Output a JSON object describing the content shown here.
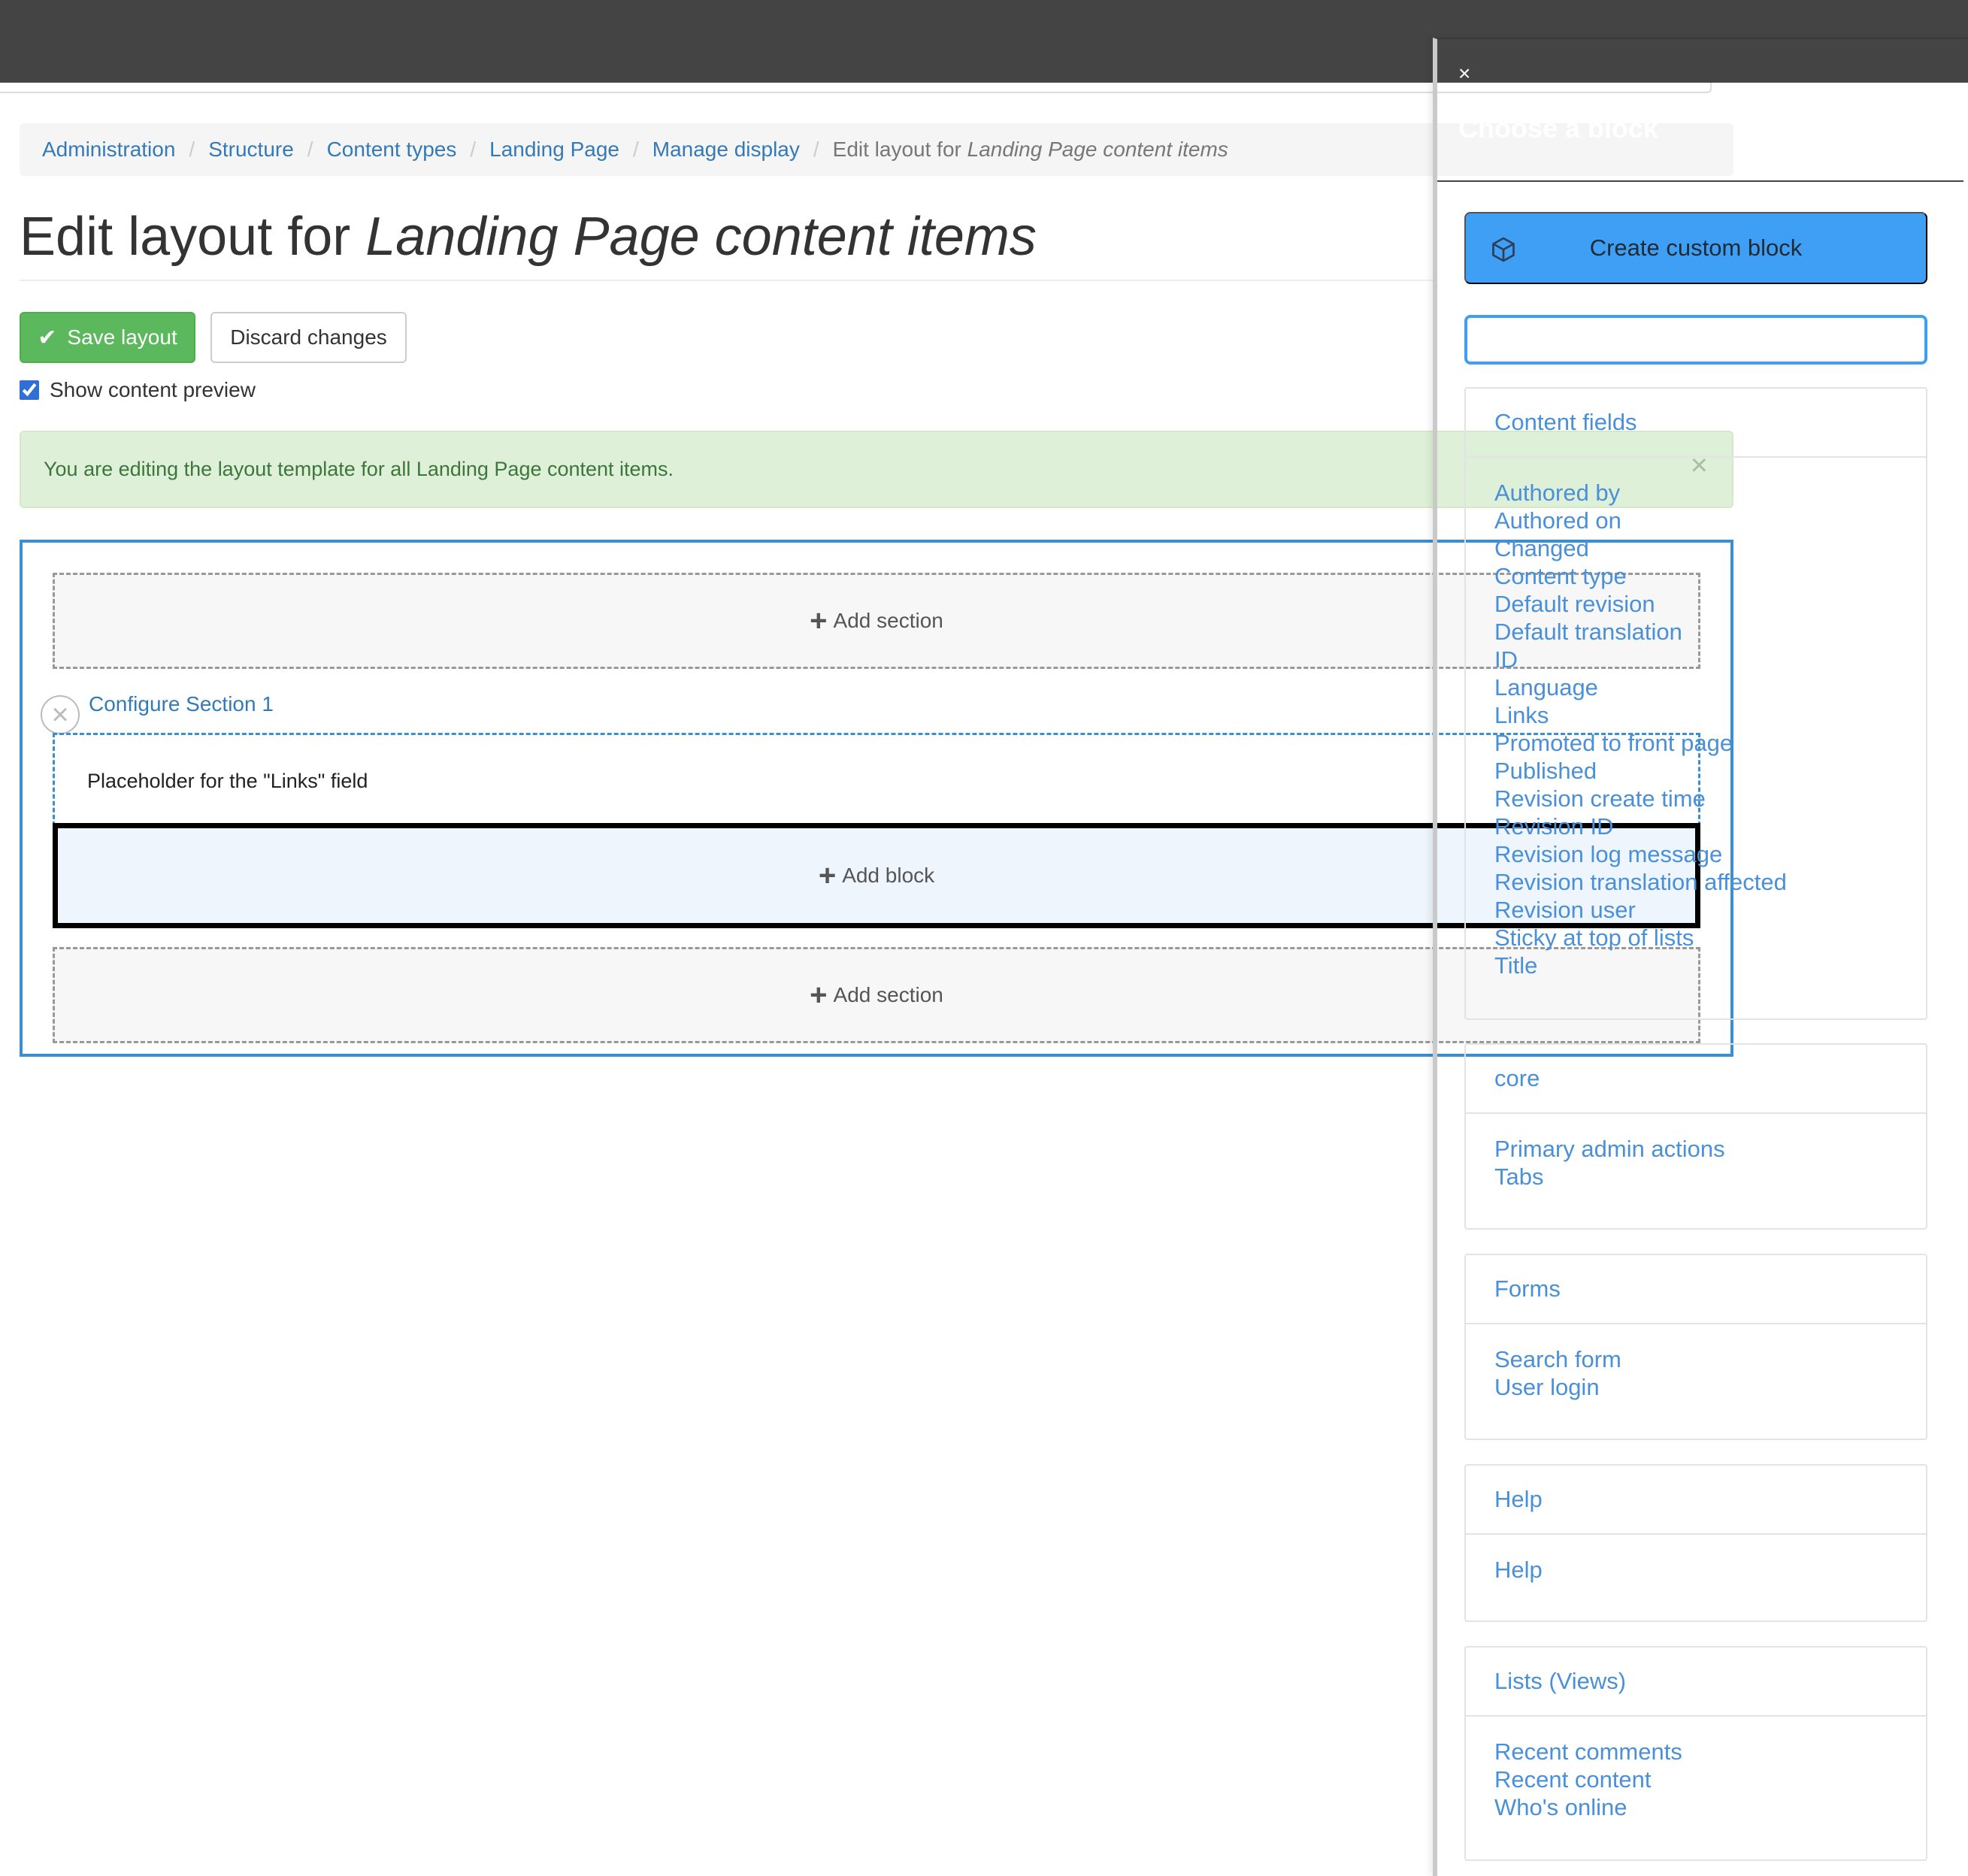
{
  "breadcrumb": {
    "items": [
      "Administration",
      "Structure",
      "Content types",
      "Landing Page",
      "Manage display"
    ],
    "active_prefix": "Edit layout for",
    "active_em": "Landing Page content items"
  },
  "page": {
    "title_prefix": "Edit layout for",
    "title_em": "Landing Page content items"
  },
  "actions": {
    "save_label": "Save layout",
    "discard_label": "Discard changes",
    "preview_label": "Show content preview",
    "preview_checked": true
  },
  "alert": {
    "message": "You are editing the layout template for all Landing Page content items.",
    "close_glyph": "×"
  },
  "builder": {
    "add_section_label": "Add section",
    "configure_section_label": "Configure Section 1",
    "placeholder_text": "Placeholder for the \"Links\" field",
    "add_block_label": "Add block",
    "plus_glyph": "+",
    "remove_glyph": "×"
  },
  "sidebar": {
    "close_glyph": "×",
    "title": "Choose a block",
    "create_block_label": "Create custom block",
    "filter_value": "",
    "categories": [
      {
        "name": "Content fields",
        "items": [
          "Authored by",
          "Authored on",
          "Changed",
          "Content type",
          "Default revision",
          "Default translation",
          "ID",
          "Language",
          "Links",
          "Promoted to front page",
          "Published",
          "Revision create time",
          "Revision ID",
          "Revision log message",
          "Revision translation affected",
          "Revision user",
          "Sticky at top of lists",
          "Title"
        ]
      },
      {
        "name": "core",
        "items": [
          "Primary admin actions",
          "Tabs"
        ]
      },
      {
        "name": "Forms",
        "items": [
          "Search form",
          "User login"
        ]
      },
      {
        "name": "Help",
        "items": [
          "Help"
        ]
      },
      {
        "name": "Lists (Views)",
        "items": [
          "Recent comments",
          "Recent content",
          "Who's online"
        ]
      }
    ]
  },
  "colors": {
    "toolbar": "#444444",
    "link": "#337ab7",
    "sidebar_link": "#4a90d9",
    "save_button": "#5cb85c",
    "alert_bg": "#dff0d8",
    "alert_text": "#3c763d",
    "outline_blue": "#3d8ecf",
    "primary_button": "#3f9ff5"
  }
}
